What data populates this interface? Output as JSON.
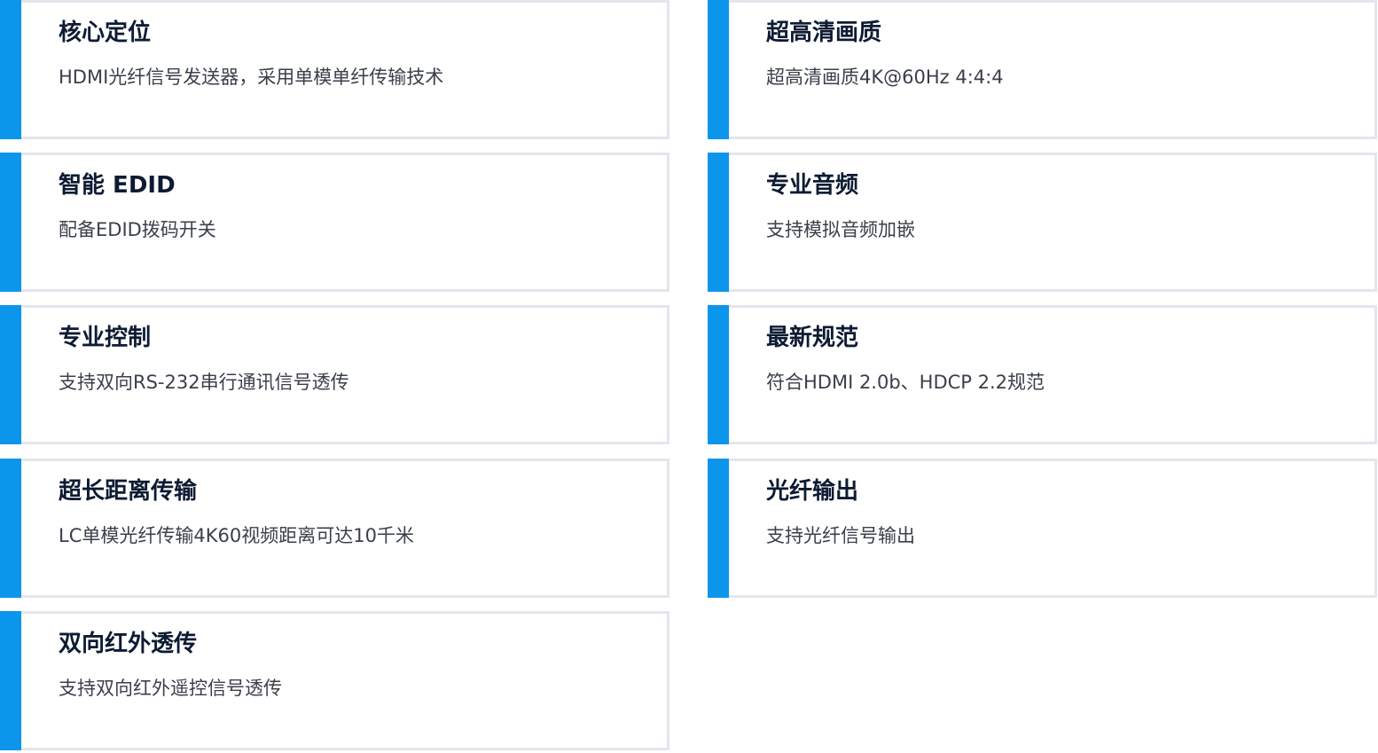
{
  "features": [
    {
      "title": "核心定位",
      "desc": "HDMI光纤信号发送器，采用单模单纤传输技术"
    },
    {
      "title": "超高清画质",
      "desc": "超高清画质4K@60Hz 4:4:4"
    },
    {
      "title": "智能 EDID",
      "desc": "配备EDID拨码开关"
    },
    {
      "title": "专业音频",
      "desc": "支持模拟音频加嵌"
    },
    {
      "title": "专业控制",
      "desc": "支持双向RS-232串行通讯信号透传"
    },
    {
      "title": "最新规范",
      "desc": "符合HDMI 2.0b、HDCP 2.2规范"
    },
    {
      "title": "超长距离传输",
      "desc": "LC单模光纤传输4K60视频距离可达10千米"
    },
    {
      "title": "光纤输出",
      "desc": "支持光纤信号输出"
    },
    {
      "title": "双向红外透传",
      "desc": "支持双向红外遥控信号透传"
    }
  ],
  "colors": {
    "accent": "#0b96ec",
    "border": "#e3e6ec",
    "title": "#0d1b33",
    "text": "#3a3f4a"
  }
}
